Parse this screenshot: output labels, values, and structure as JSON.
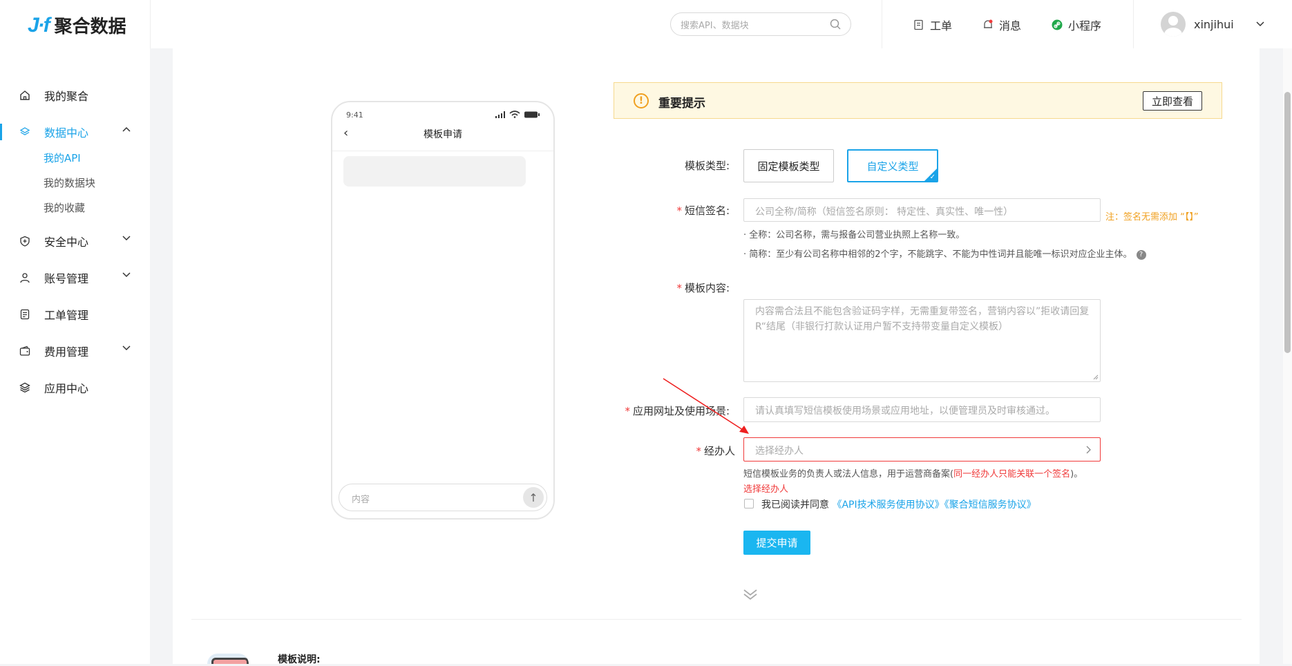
{
  "header": {
    "logo_mark": "J·f",
    "logo_text": "聚合数据",
    "search_placeholder": "搜索API、数据块",
    "links": [
      {
        "label": "工单",
        "icon": "ticket-icon"
      },
      {
        "label": "消息",
        "icon": "bell-icon"
      },
      {
        "label": "小程序",
        "icon": "link-icon"
      }
    ],
    "username": "xinjihui"
  },
  "sidebar": {
    "items": [
      {
        "label": "我的聚合",
        "icon": "home-icon"
      },
      {
        "label": "数据中心",
        "icon": "layers-icon",
        "expanded": true
      },
      {
        "label": "安全中心",
        "icon": "shield-icon"
      },
      {
        "label": "账号管理",
        "icon": "user-icon"
      },
      {
        "label": "工单管理",
        "icon": "document-icon"
      },
      {
        "label": "费用管理",
        "icon": "wallet-icon"
      },
      {
        "label": "应用中心",
        "icon": "stack-icon"
      }
    ],
    "sub_items": [
      "我的API",
      "我的数据块",
      "我的收藏"
    ]
  },
  "phone": {
    "time": "9:41",
    "title": "模板申请",
    "input_placeholder": "内容"
  },
  "notice": {
    "title": "重要提示",
    "button": "立即查看"
  },
  "form": {
    "template_type_label": "模板类型:",
    "template_types": [
      "固定模板类型",
      "自定义类型"
    ],
    "signature_label": "短信签名:",
    "signature_placeholder": "公司全称/简称（短信签名原则： 特定性、真实性、唯一性）",
    "signature_note": "注：签名无需添加 “【】”",
    "signature_hint_full": "· 全称：公司名称，需与报备公司营业执照上名称一致。",
    "signature_hint_short": "· 简称：至少有公司名称中相邻的2个字，不能跳字、不能为中性词并且能唯一标识对应企业主体。",
    "content_label": "模板内容:",
    "content_placeholder": "内容需合法且不能包含验证码字样，无需重复带签名，营销内容以”拒收请回复R“结尾（非银行打款认证用户暂不支持带变量自定义模板）",
    "app_url_label": "应用网址及使用场景:",
    "app_url_placeholder": "请认真填写短信模板使用场景或应用地址，以便管理员及时审核通过。",
    "handler_label": "经办人",
    "handler_placeholder": "选择经办人",
    "handler_hint": "短信模板业务的负责人或法人信息，用于运营商备案(",
    "handler_hint_red": "同一经办人只能关联一个签名",
    "handler_hint_end": ")。",
    "handler_error": "选择经办人",
    "agree_text": "我已阅读并同意",
    "agree_link1": "《API技术服务使用协议》",
    "agree_link2": "《聚合短信服务协议》",
    "submit": "提交申请"
  },
  "bottom": {
    "title": "模板说明:"
  },
  "colors": {
    "accent": "#1aa3e8",
    "error": "#f03a3a",
    "warning": "#f0a020"
  }
}
